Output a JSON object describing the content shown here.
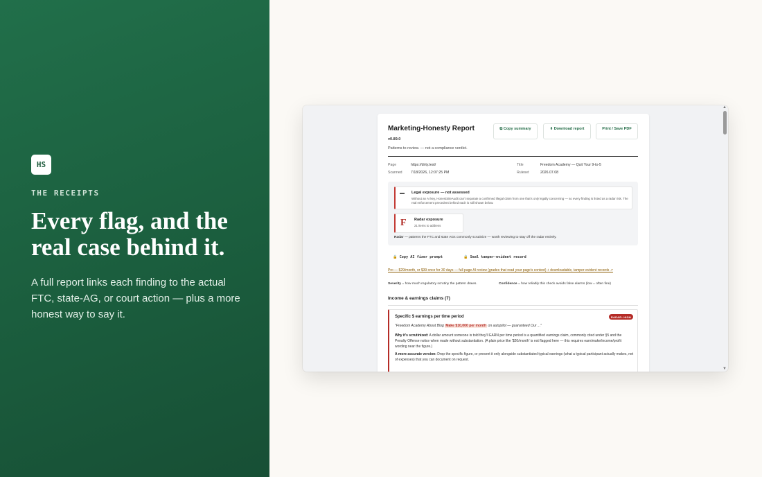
{
  "left": {
    "logo": "HS",
    "eyebrow": "THE RECEIPTS",
    "headline": "Every flag, and the real case behind it.",
    "subtitle": "A full report links each finding to the actual FTC, state-AG, or court action — plus a more honest way to say it."
  },
  "report": {
    "title": "Marketing-Honesty Report",
    "version": "v0.89.0",
    "disclaimer": "Patterns to review. — not a compliance verdict.",
    "buttons": {
      "copy": "⧉ Copy summary",
      "download": "⬇ Download report",
      "print": "Print / Save PDF"
    },
    "meta": {
      "page_label": "Page",
      "page_value": "https://dirty.test/",
      "scanned_label": "Scanned",
      "scanned_value": "7/18/2026, 12:07:25 PM",
      "title_label": "Title",
      "title_value": "Freedom Academy — Quit Your 9-to-5",
      "ruleset_label": "Ruleset",
      "ruleset_value": "2026.07.08"
    },
    "legal": {
      "title": "Legal exposure — not assessed",
      "text": "Without an AI key, HonestSiteAudit can't separate a confirmed illegal claim from one that's only legally concerning — so every finding is listed as a radar risk. The real enforcement precedent behind each is still shown below."
    },
    "radar": {
      "grade": "F",
      "title": "Radar exposure",
      "count": "21 items to address",
      "note_bold": "Radar",
      "note": " — patterns the FTC and state AGs commonly scrutinize — worth reviewing to stay off the radar entirely."
    },
    "tools": {
      "copy_prompt": "🔒 Copy AI fixer prompt",
      "seal": "🔒 Seal tamper-evident record"
    },
    "pro": "Pro — $29/month, or $39 once for 30 days — full page AI review (grades that read your page's context) + downloadable, tamper-evident records ↗",
    "legend": {
      "severity_bold": "Severity",
      "severity": " = how much regulatory scrutiny the pattern draws.",
      "confidence_bold": "Confidence",
      "confidence": " = how reliably this check avoids false alarms (low = often fine)"
    },
    "section": "Income & earnings claims (7)",
    "finding": {
      "title": "Specific $ earnings per time period",
      "badge": "RADAR: HIGH",
      "quote_pre": "\"Freedom Academy About Blog ",
      "quote_hl": "Make $10,000 per month",
      "quote_post": " on autopilot — guaranteed Our ...\"",
      "why_label": "Why it's scrutinized:",
      "why": " A dollar amount someone is told they'll EARN per time period is a quantified earnings claim, commonly cited under §5 and the Penalty Offense notice when made without substantiation. (A plain price like '$20/month' is not flagged here — this requires earn/make/income/profit wording near the figure.)",
      "accurate_label": "A more accurate version:",
      "accurate": " Drop the specific figure, or present it only alongside substantiated typical earnings (what a typical participant actually makes, net of expenses) that you can document on request."
    }
  }
}
